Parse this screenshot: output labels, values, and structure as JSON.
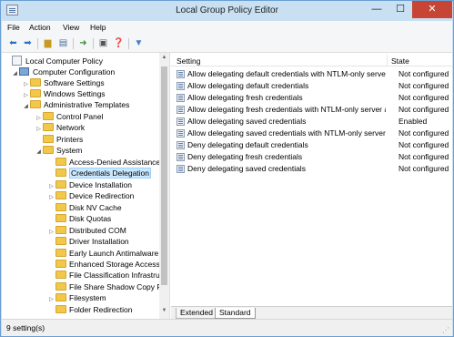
{
  "window": {
    "title": "Local Group Policy Editor",
    "minimize": "—",
    "maximize": "☐",
    "close": "✕"
  },
  "menu": [
    "File",
    "Action",
    "View",
    "Help"
  ],
  "toolbar": [
    "back-arrow",
    "forward-arrow",
    "up-folder",
    "show-hide-tree",
    "export-list",
    "properties",
    "help",
    "filter"
  ],
  "tree": [
    {
      "label": "Local Computer Policy",
      "icon": "policy-icon",
      "expander": ""
    },
    {
      "label": "Computer Configuration",
      "icon": "computer-icon",
      "expander": "◢"
    },
    {
      "label": "Software Settings",
      "icon": "folder-icon",
      "expander": "▷"
    },
    {
      "label": "Windows Settings",
      "icon": "folder-icon",
      "expander": "▷"
    },
    {
      "label": "Administrative Templates",
      "icon": "folder-icon",
      "expander": "◢"
    },
    {
      "label": "Control Panel",
      "icon": "folder-icon",
      "expander": "▷"
    },
    {
      "label": "Network",
      "icon": "folder-icon",
      "expander": "▷"
    },
    {
      "label": "Printers",
      "icon": "folder-icon",
      "expander": ""
    },
    {
      "label": "System",
      "icon": "folder-icon",
      "expander": "◢"
    },
    {
      "label": "Access-Denied Assistance",
      "icon": "folder-icon",
      "expander": ""
    },
    {
      "label": "Credentials Delegation",
      "icon": "folder-icon",
      "expander": "",
      "selected": true
    },
    {
      "label": "Device Installation",
      "icon": "folder-icon",
      "expander": "▷"
    },
    {
      "label": "Device Redirection",
      "icon": "folder-icon",
      "expander": "▷"
    },
    {
      "label": "Disk NV Cache",
      "icon": "folder-icon",
      "expander": ""
    },
    {
      "label": "Disk Quotas",
      "icon": "folder-icon",
      "expander": ""
    },
    {
      "label": "Distributed COM",
      "icon": "folder-icon",
      "expander": "▷"
    },
    {
      "label": "Driver Installation",
      "icon": "folder-icon",
      "expander": ""
    },
    {
      "label": "Early Launch Antimalware",
      "icon": "folder-icon",
      "expander": ""
    },
    {
      "label": "Enhanced Storage Access",
      "icon": "folder-icon",
      "expander": ""
    },
    {
      "label": "File Classification Infrastructu",
      "icon": "folder-icon",
      "expander": ""
    },
    {
      "label": "File Share Shadow Copy Pr",
      "icon": "folder-icon",
      "expander": ""
    },
    {
      "label": "Filesystem",
      "icon": "folder-icon",
      "expander": "▷"
    },
    {
      "label": "Folder Redirection",
      "icon": "folder-icon",
      "expander": ""
    }
  ],
  "list": {
    "columns": [
      "Setting",
      "State"
    ],
    "rows": [
      {
        "name": "Allow delegating default credentials with NTLM-only server ...",
        "state": "Not configured"
      },
      {
        "name": "Allow delegating default credentials",
        "state": "Not configured"
      },
      {
        "name": "Allow delegating fresh credentials",
        "state": "Not configured"
      },
      {
        "name": "Allow delegating fresh credentials with NTLM-only server a...",
        "state": "Not configured"
      },
      {
        "name": "Allow delegating saved credentials",
        "state": "Enabled"
      },
      {
        "name": "Allow delegating saved credentials with NTLM-only server a...",
        "state": "Not configured"
      },
      {
        "name": "Deny delegating default credentials",
        "state": "Not configured"
      },
      {
        "name": "Deny delegating fresh credentials",
        "state": "Not configured"
      },
      {
        "name": "Deny delegating saved credentials",
        "state": "Not configured"
      }
    ]
  },
  "tabs": [
    "Extended",
    "Standard"
  ],
  "status": "9 setting(s)"
}
